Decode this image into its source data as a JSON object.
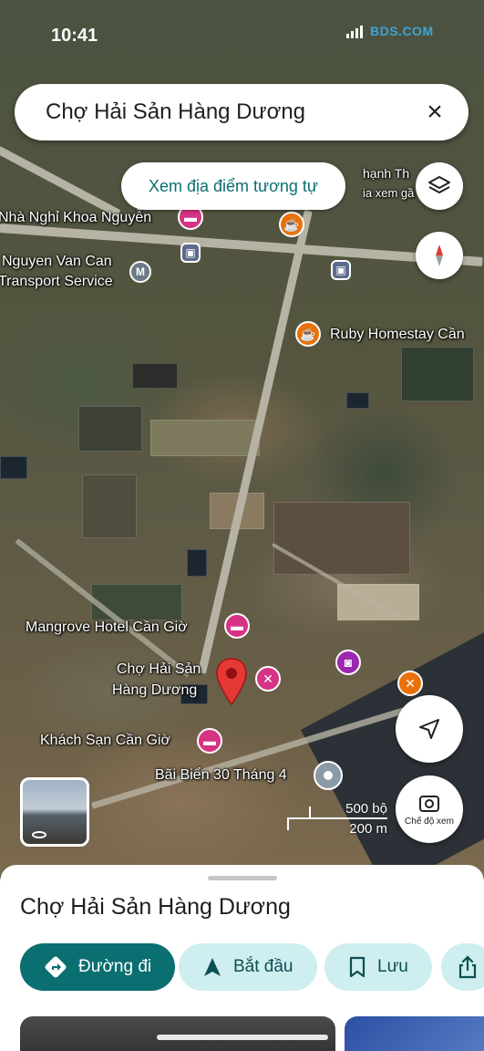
{
  "status": {
    "time": "10:41",
    "brand": "BDS.COM"
  },
  "search": {
    "query": "Chợ Hải Sản Hàng Dương"
  },
  "chips": {
    "similar_places": "Xem địa điểm tương tự"
  },
  "map": {
    "labels": {
      "nha_nghi": "Nhà Nghỉ Khoa Nguyễn",
      "nguyen_van_can_1": "Nguyen Van Can",
      "nguyen_van_can_2": "Transport Service",
      "ruby": "Ruby Homestay Cần",
      "mangrove": "Mangrove Hotel Cần Giờ",
      "market_1": "Chợ Hải Sản",
      "market_2": "Hàng Dương",
      "khach_san": "Khách Sạn Cần Giờ",
      "bai_bien": "Bãi Biển 30 Tháng 4",
      "partial_top_1": "hạnh Th",
      "partial_top_2": "ia xem gầ"
    },
    "scale": {
      "imperial": "500 bộ",
      "metric": "200 m"
    },
    "view_mode_label": "Chế độ xem"
  },
  "sheet": {
    "title": "Chợ Hải Sản Hàng Dương",
    "actions": {
      "directions": "Đường đi",
      "start": "Bắt đầu",
      "save": "Lưu"
    }
  },
  "colors": {
    "accent": "#0b6e71",
    "accent_light": "#cfeeef",
    "pin": "#e53935"
  }
}
